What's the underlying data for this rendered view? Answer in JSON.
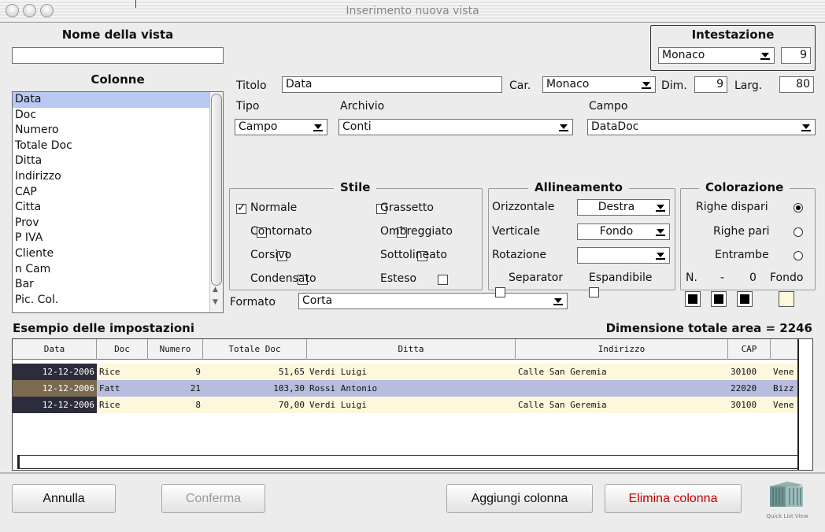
{
  "window": {
    "title": "Inserimento nuova vista"
  },
  "view_name": {
    "label": "Nome della vista",
    "value": ""
  },
  "header": {
    "label": "Intestazione",
    "font": "Monaco",
    "size": "9"
  },
  "columns": {
    "label": "Colonne",
    "items": [
      "Data",
      "Doc",
      "Numero",
      "Totale Doc",
      "Ditta",
      "Indirizzo",
      "CAP",
      "Citta",
      "Prov",
      "P IVA",
      "Cliente",
      "n Cam",
      "Bar",
      "Pic. Col."
    ],
    "selected": "Data"
  },
  "column_settings": {
    "title_label": "Titolo",
    "title_value": "Data",
    "char_label": "Car.",
    "char_value": "Monaco",
    "dim_label": "Dim.",
    "dim_value": "9",
    "width_label": "Larg.",
    "width_value": "80",
    "type_label": "Tipo",
    "type_value": "Campo",
    "archive_label": "Archivio",
    "archive_value": "Conti",
    "field_label": "Campo",
    "field_value": "DataDoc"
  },
  "style": {
    "title": "Stile",
    "options": [
      {
        "label": "Normale",
        "checked": true
      },
      {
        "label": "Grassetto",
        "checked": false
      },
      {
        "label": "Contornato",
        "checked": false
      },
      {
        "label": "Ombreggiato",
        "checked": false
      },
      {
        "label": "Corsivo",
        "checked": false
      },
      {
        "label": "Sottolineato",
        "checked": false
      },
      {
        "label": "Condensato",
        "checked": false
      },
      {
        "label": "Esteso",
        "checked": false
      }
    ],
    "format_label": "Formato",
    "format_value": "Corta"
  },
  "alignment": {
    "title": "Allineamento",
    "horizontal_label": "Orizzontale",
    "horizontal_value": "Destra",
    "vertical_label": "Verticale",
    "vertical_value": "Fondo",
    "rotation_label": "Rotazione",
    "rotation_value": "",
    "separator_label": "Separator",
    "expandable_label": "Espandibile"
  },
  "coloring": {
    "title": "Colorazione",
    "odd_label": "Righe dispari",
    "even_label": "Righe pari",
    "both_label": "Entrambe",
    "selected": "Righe dispari",
    "n_label": "N.",
    "dash": "-",
    "zero": "0",
    "fondo_label": "Fondo"
  },
  "preview": {
    "label": "Esempio delle impostazioni",
    "total_area": "Dimensione totale area = 2246",
    "columns": [
      "Data",
      "Doc",
      "Numero",
      "Totale Doc",
      "Ditta",
      "Indirizzo",
      "CAP"
    ],
    "rows": [
      {
        "data": "12-12-2006",
        "doc": "Rice",
        "numero": "9",
        "totale": "51,65",
        "ditta": "Verdi   Luigi",
        "indirizzo": "Calle San Geremia",
        "cap": "30100",
        "extra": "Vene"
      },
      {
        "data": "12-12-2006",
        "doc": "Fatt",
        "numero": "21",
        "totale": "103,30",
        "ditta": "Rossi   Antonio",
        "indirizzo": "",
        "cap": "22020",
        "extra": "Bizz"
      },
      {
        "data": "12-12-2006",
        "doc": "Rice",
        "numero": "8",
        "totale": "70,00",
        "ditta": "Verdi   Luigi",
        "indirizzo": "Calle San Geremia",
        "cap": "30100",
        "extra": "Vene"
      }
    ]
  },
  "buttons": {
    "cancel": "Annulla",
    "confirm": "Conferma",
    "add_column": "Aggiungi colonna",
    "delete_column": "Elimina colonna"
  },
  "logo": {
    "text": "Quick List View"
  },
  "colors": {
    "delete_text": "#cc0000",
    "selection": "#b9c9f2",
    "row_odd": "#fdf8dc",
    "row_even": "#b8bddf"
  }
}
